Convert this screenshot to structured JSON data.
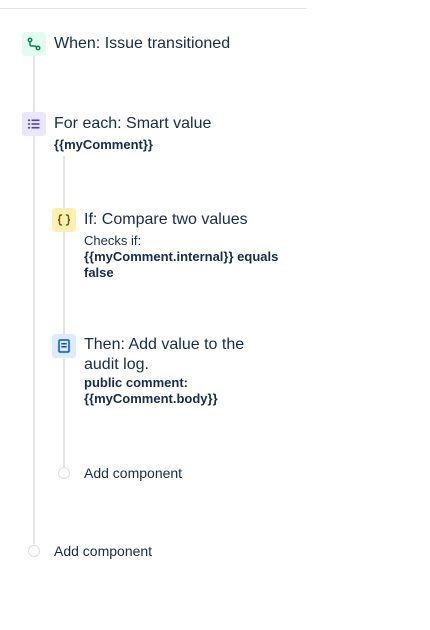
{
  "trigger": {
    "title": "When: Issue transitioned",
    "icon": "transition-icon",
    "color": "#00875a"
  },
  "branch": {
    "title": "For each: Smart value",
    "value": "{{myComment}}",
    "icon": "list-icon",
    "color": "#5243aa"
  },
  "condition": {
    "title": "If: Compare two values",
    "label": "Checks if:",
    "value": "{{myComment.internal}} equals false",
    "icon": "braces-icon",
    "color": "#ff991f"
  },
  "action": {
    "title": "Then: Add value to the audit log.",
    "value": "public comment: {{myComment.body}}",
    "icon": "document-icon",
    "color": "#0052cc"
  },
  "add_component_inner": "Add component",
  "add_component_outer": "Add component"
}
